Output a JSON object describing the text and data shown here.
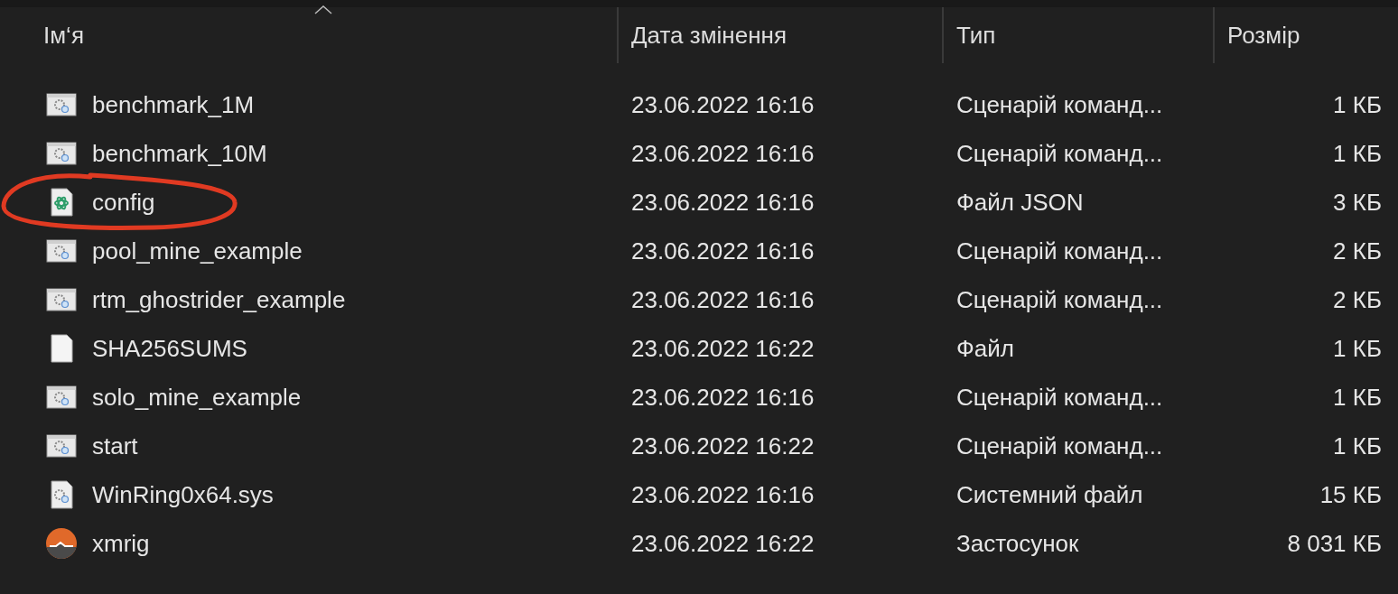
{
  "table": {
    "columns": [
      {
        "label": "Ім‘я",
        "sorted": true
      },
      {
        "label": "Дата змінення",
        "sorted": false
      },
      {
        "label": "Тип",
        "sorted": false
      },
      {
        "label": "Розмір",
        "sorted": false
      }
    ],
    "rows": [
      {
        "kind": "script",
        "name": "benchmark_1M",
        "date": "23.06.2022 16:16",
        "type": "Сценарій команд...",
        "size": "1 КБ",
        "circled": false
      },
      {
        "kind": "script",
        "name": "benchmark_10M",
        "date": "23.06.2022 16:16",
        "type": "Сценарій команд...",
        "size": "1 КБ",
        "circled": false
      },
      {
        "kind": "json",
        "name": "config",
        "date": "23.06.2022 16:16",
        "type": "Файл JSON",
        "size": "3 КБ",
        "circled": true
      },
      {
        "kind": "script",
        "name": "pool_mine_example",
        "date": "23.06.2022 16:16",
        "type": "Сценарій команд...",
        "size": "2 КБ",
        "circled": false
      },
      {
        "kind": "script",
        "name": "rtm_ghostrider_example",
        "date": "23.06.2022 16:16",
        "type": "Сценарій команд...",
        "size": "2 КБ",
        "circled": false
      },
      {
        "kind": "blank",
        "name": "SHA256SUMS",
        "date": "23.06.2022 16:22",
        "type": "Файл",
        "size": "1 КБ",
        "circled": false
      },
      {
        "kind": "script",
        "name": "solo_mine_example",
        "date": "23.06.2022 16:16",
        "type": "Сценарій команд...",
        "size": "1 КБ",
        "circled": false
      },
      {
        "kind": "script",
        "name": "start",
        "date": "23.06.2022 16:22",
        "type": "Сценарій команд...",
        "size": "1 КБ",
        "circled": false
      },
      {
        "kind": "system",
        "name": "WinRing0x64.sys",
        "date": "23.06.2022 16:16",
        "type": "Системний файл",
        "size": "15 КБ",
        "circled": false
      },
      {
        "kind": "app",
        "name": "xmrig",
        "date": "23.06.2022 16:22",
        "type": "Застосунок",
        "size": "8 031 КБ",
        "circled": false
      }
    ]
  }
}
